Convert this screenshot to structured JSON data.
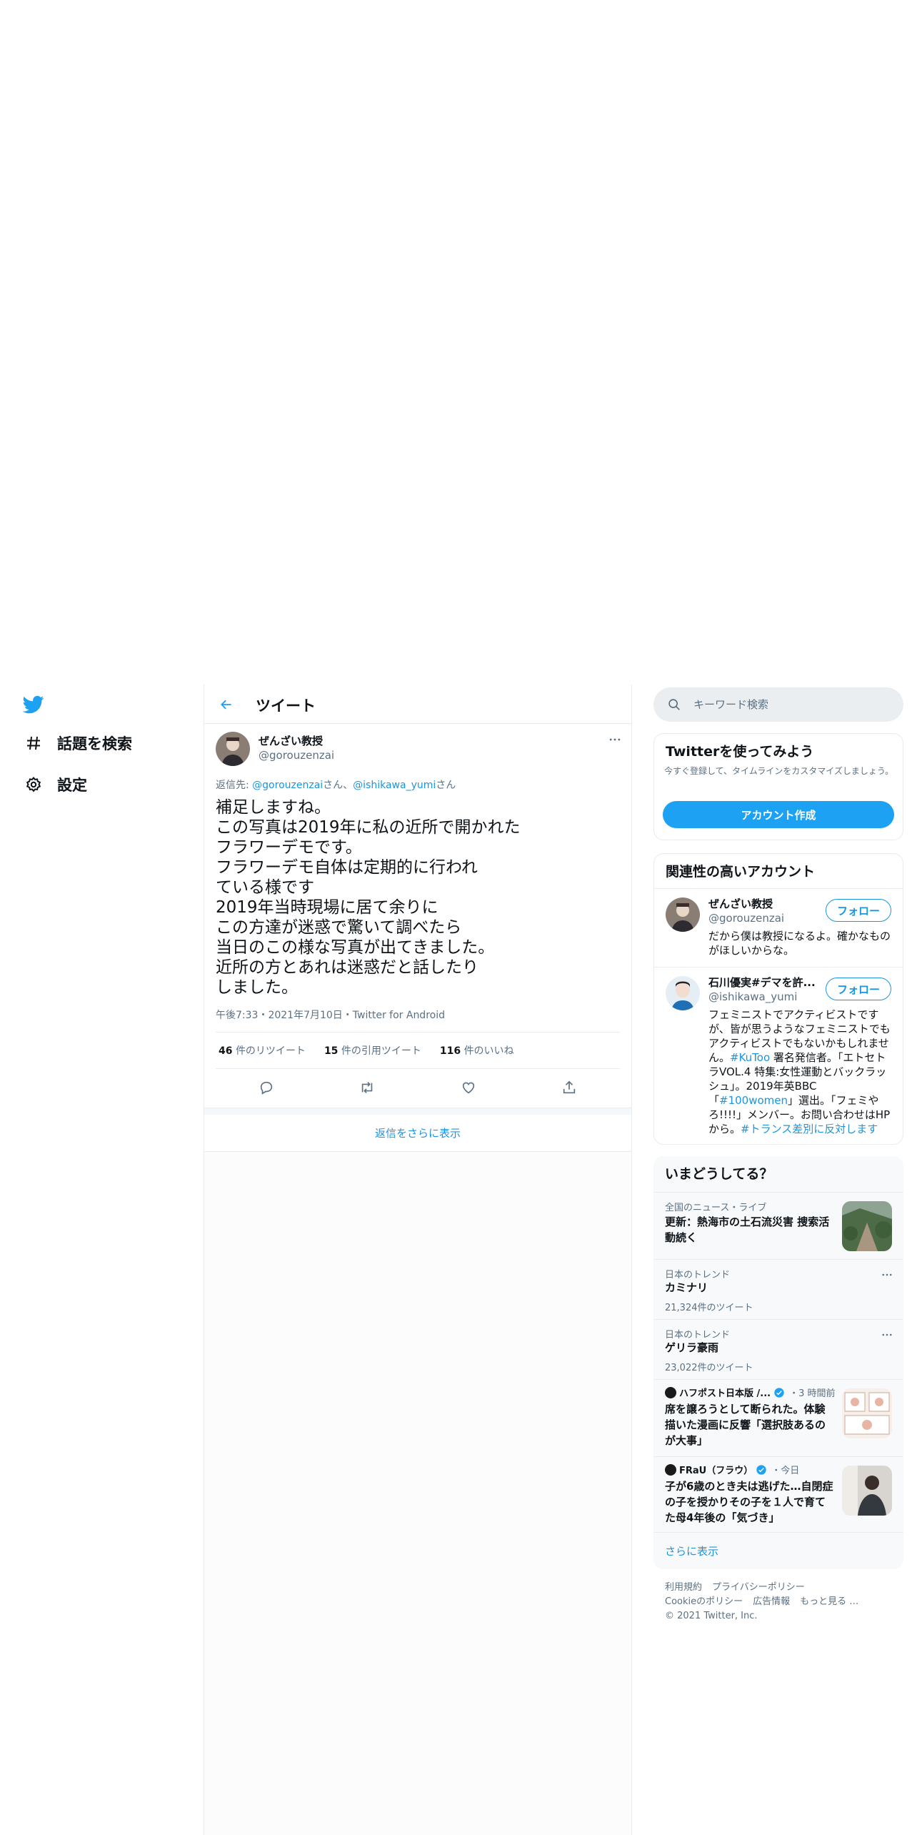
{
  "nav": {
    "items": [
      {
        "label": "話題を検索",
        "icon": "hashtag-icon"
      },
      {
        "label": "設定",
        "icon": "gear-icon"
      }
    ]
  },
  "header": {
    "title": "ツイート"
  },
  "tweet": {
    "author_name": "ぜんざい教授",
    "author_handle": "@gorouzenzai",
    "reply_prefix": "返信先: ",
    "reply_user1": "@gorouzenzai",
    "reply_sep1": "さん、",
    "reply_user2": "@ishikawa_yumi",
    "reply_sep2": "さん",
    "text": "補足しますね。\nこの写真は2019年に私の近所で開かれた\nフラワーデモです。\nフラワーデモ自体は定期的に行われ\nている様です\n2019年当時現場に居て余りに\nこの方達が迷惑で驚いて調べたら\n当日のこの様な写真が出てきました。\n近所の方とあれは迷惑だと話したり\nしました。",
    "meta": "午後7:33・2021年7月10日・Twitter for Android",
    "retweets_count": "46",
    "retweets_label": "件のリツイート",
    "quotes_count": "15",
    "quotes_label": "件の引用ツイート",
    "likes_count": "116",
    "likes_label": "件のいいね"
  },
  "more_replies": "返信をさらに表示",
  "search": {
    "placeholder": "キーワード検索"
  },
  "signup": {
    "title": "Twitterを使ってみよう",
    "desc": "今すぐ登録して、タイムラインをカスタマイズしましょう。",
    "button": "アカウント作成"
  },
  "related": {
    "title": "関連性の高いアカウント",
    "follow_label": "フォロー",
    "accounts": [
      {
        "name": "ぜんざい教授",
        "handle": "@gorouzenzai",
        "bio": "だから僕は教授になるよ。確かなものがほしいからな。"
      },
      {
        "name": "石川優実#デマを許...",
        "handle": "@ishikawa_yumi",
        "bio_a": "フェミニストでアクティビストですが、皆が思うようなフェミニストでもアクティビストでもないかもしれません。",
        "bio_tag1": "#KuToo",
        "bio_b": " 署名発信者。「エトセトラVOL.4 特集:女性運動とバックラッシュ」。2019年英BBC「",
        "bio_tag2": "#100women",
        "bio_c": "」選出。「フェミやろ!!!!」メンバー。お問い合わせはHPから。",
        "bio_tag3": "#トランス差別に反対します"
      }
    ]
  },
  "trends": {
    "title": "いまどうしてる？",
    "items": [
      {
        "category": "全国のニュース・ライブ",
        "title": "更新：熱海市の土石流災害 捜索活動続く"
      },
      {
        "category": "日本のトレンド",
        "title": "カミナリ",
        "count": "21,324件のツイート"
      },
      {
        "category": "日本のトレンド",
        "title": "ゲリラ豪雨",
        "count": "23,022件のツイート"
      },
      {
        "publisher": "ハフポスト日本版 /...",
        "time": "・3 時間前",
        "title": "席を譲ろうとして断られた。体験描いた漫画に反響「選択肢あるのが大事」"
      },
      {
        "publisher": "FRaU（フラウ）",
        "time": "・今日",
        "title": "子が6歳のとき夫は逃げた…自閉症の子を授かりその子を１人で育てた母4年後の「気づき」"
      }
    ],
    "show_more": "さらに表示"
  },
  "footer": {
    "links": [
      "利用規約",
      "プライバシーポリシー",
      "Cookieのポリシー",
      "広告情報",
      "もっと見る …"
    ],
    "copyright": "© 2021 Twitter, Inc."
  },
  "colors": {
    "accent": "#1da1f2",
    "link": "#1b95e0",
    "text": "#0f1419",
    "muted": "#5b7083"
  }
}
